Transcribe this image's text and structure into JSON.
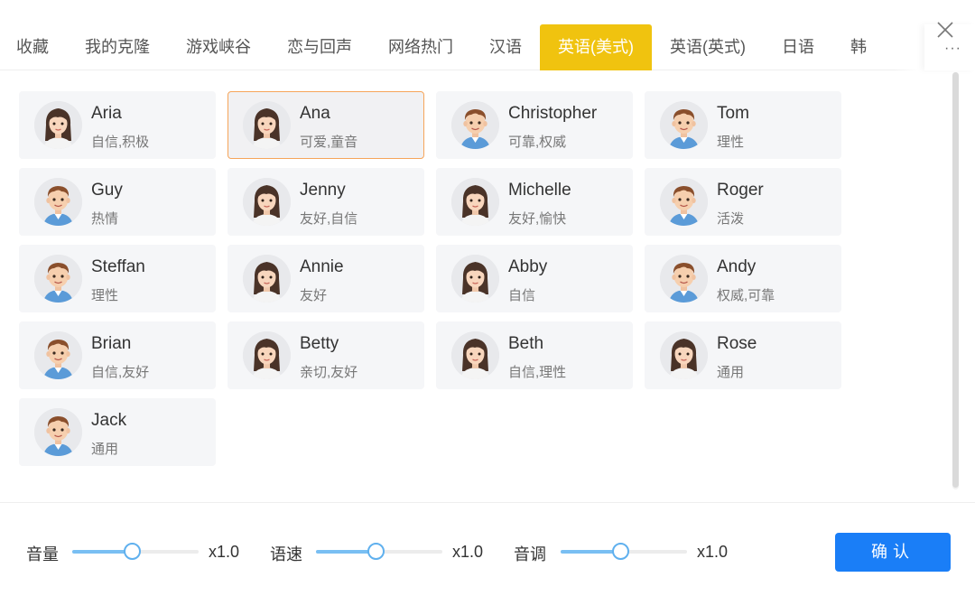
{
  "tabs": [
    {
      "label": "收藏"
    },
    {
      "label": "我的克隆"
    },
    {
      "label": "游戏峡谷"
    },
    {
      "label": "恋与回声"
    },
    {
      "label": "网络热门"
    },
    {
      "label": "汉语"
    },
    {
      "label": "英语(美式)",
      "active": true
    },
    {
      "label": "英语(英式)"
    },
    {
      "label": "日语"
    },
    {
      "label": "韩"
    }
  ],
  "more_label": "···",
  "voices": [
    {
      "name": "Aria",
      "desc": "自信,积极",
      "gender": "female"
    },
    {
      "name": "Ana",
      "desc": "可爱,童音",
      "gender": "female",
      "selected": true
    },
    {
      "name": "Christopher",
      "desc": "可靠,权威",
      "gender": "male"
    },
    {
      "name": "Tom",
      "desc": "理性",
      "gender": "male"
    },
    {
      "name": "Guy",
      "desc": "热情",
      "gender": "male"
    },
    {
      "name": "Jenny",
      "desc": "友好,自信",
      "gender": "female"
    },
    {
      "name": "Michelle",
      "desc": "友好,愉快",
      "gender": "female"
    },
    {
      "name": "Roger",
      "desc": "活泼",
      "gender": "male"
    },
    {
      "name": "Steffan",
      "desc": "理性",
      "gender": "male"
    },
    {
      "name": "Annie",
      "desc": "友好",
      "gender": "female"
    },
    {
      "name": "Abby",
      "desc": "自信",
      "gender": "female"
    },
    {
      "name": "Andy",
      "desc": "权威,可靠",
      "gender": "male"
    },
    {
      "name": "Brian",
      "desc": "自信,友好",
      "gender": "male"
    },
    {
      "name": "Betty",
      "desc": "亲切,友好",
      "gender": "female"
    },
    {
      "name": "Beth",
      "desc": "自信,理性",
      "gender": "female"
    },
    {
      "name": "Rose",
      "desc": "通用",
      "gender": "female"
    },
    {
      "name": "Jack",
      "desc": "通用",
      "gender": "male"
    }
  ],
  "controls": {
    "volume": {
      "label": "音量",
      "value": "x1.0",
      "level": 0.47
    },
    "speed": {
      "label": "语速",
      "value": "x1.0",
      "level": 0.47
    },
    "pitch": {
      "label": "音调",
      "value": "x1.0",
      "level": 0.47
    }
  },
  "confirm_label": "确认",
  "colors": {
    "active_tab": "#f0c30f",
    "selected_border": "#f6a55a",
    "slider": "#79bff3",
    "confirm": "#1a7ef7"
  }
}
